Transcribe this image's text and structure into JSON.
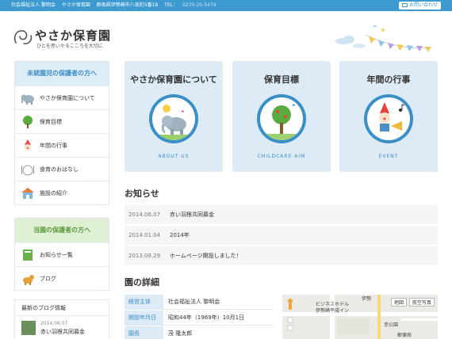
{
  "topbar": {
    "org": "社会福祉法人 黎明会",
    "nursery": "やさか保育園",
    "address": "群馬県伊勢崎市八坂町5番18",
    "tel_label": "TEL：",
    "tel_number": "0270-25-5474",
    "contact_label": "お問い合わせ"
  },
  "logo": {
    "title": "やさか保育園",
    "subtitle": "ひとを思いやるこころを大切に"
  },
  "sidebar": {
    "section1_title": "未就園児の保護者の方へ",
    "section1_items": [
      {
        "label": "やさか保育園について",
        "icon": "elephant-icon"
      },
      {
        "label": "保育目標",
        "icon": "tree-icon"
      },
      {
        "label": "年間の行事",
        "icon": "clown-icon"
      },
      {
        "label": "食育のおはなし",
        "icon": "meal-icon"
      },
      {
        "label": "施設の紹介",
        "icon": "building-icon"
      }
    ],
    "section2_title": "当園の保護者の方へ",
    "section2_items": [
      {
        "label": "お知らせ一覧",
        "icon": "notebook-icon"
      },
      {
        "label": "ブログ",
        "icon": "dog-icon"
      }
    ],
    "blog_title": "最新のブログ情報",
    "blog_entry": {
      "date": "2014.06.07",
      "title": "赤い羽根共同募金"
    }
  },
  "cards": [
    {
      "title": "やさか保育園について",
      "en": "ABOUT US"
    },
    {
      "title": "保育目標",
      "en": "CHILDCARE AIM"
    },
    {
      "title": "年間の行事",
      "en": "EVENT"
    }
  ],
  "news": {
    "title": "お知らせ",
    "items": [
      {
        "date": "2014.06.07",
        "text": "赤い羽根共同募金"
      },
      {
        "date": "2014.01.04",
        "text": "2014年"
      },
      {
        "date": "2013.08.29",
        "text": "ホームページ開設しました！"
      }
    ]
  },
  "details": {
    "title": "園の詳細",
    "rows": [
      {
        "key": "経営主体",
        "value": "社会福祉法人 黎明会"
      },
      {
        "key": "開設年月日",
        "value": "昭和44年（1969年）10月1日"
      },
      {
        "key": "園長",
        "value": "茂 隆太郎"
      }
    ]
  },
  "map": {
    "btn_map": "地図",
    "btn_satellite": "航空写真",
    "label_hotel": "ビジネスホテル",
    "label_hotel2": "伊勢崎平成イン",
    "label_post": "郵便局",
    "label_park": "幸公園",
    "label_city": "伊勢"
  },
  "colors": {
    "accent": "#3c9ad0",
    "card_bg": "#dcebf6",
    "green": "#5a9a3a"
  }
}
